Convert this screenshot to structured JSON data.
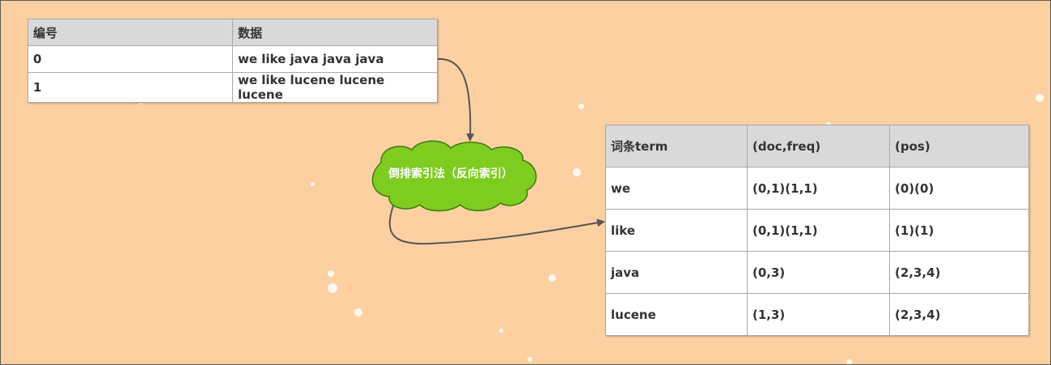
{
  "source_table": {
    "headers": [
      "编号",
      "数据"
    ],
    "rows": [
      [
        "0",
        "we like java java java"
      ],
      [
        "1",
        "we like lucene lucene lucene"
      ]
    ]
  },
  "process_node": {
    "label": "倒排索引法（反向索引）",
    "color": "#7dcc1f"
  },
  "index_table": {
    "headers": [
      "词条term",
      "(doc,freq)",
      "(pos)"
    ],
    "rows": [
      [
        "we",
        "(0,1)(1,1)",
        "(0)(0)"
      ],
      [
        "like",
        "(0,1)(1,1)",
        "(1)(1)"
      ],
      [
        "java",
        "(0,3)",
        "(2,3,4)"
      ],
      [
        "lucene",
        "(1,3)",
        "(2,3,4)"
      ]
    ]
  },
  "colors": {
    "background": "#fdd0a2",
    "header": "#d9d9d9",
    "edge": "#555555"
  }
}
